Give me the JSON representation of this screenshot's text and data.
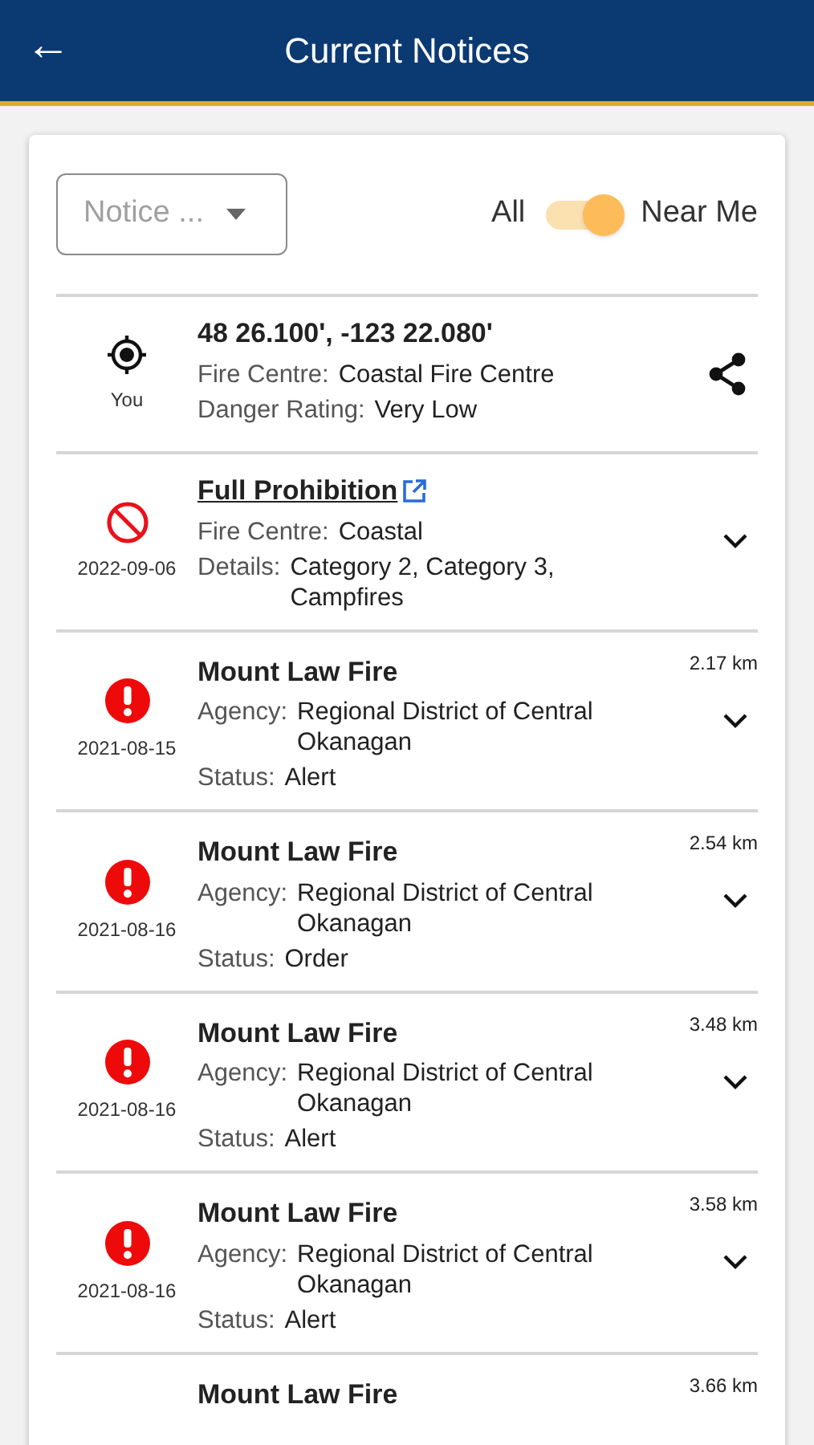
{
  "header": {
    "back": "←",
    "title": "Current Notices"
  },
  "filter": {
    "placeholder": "Notice ..."
  },
  "toggle": {
    "left_label": "All",
    "right_label": "Near Me",
    "on": true
  },
  "rows": [
    {
      "kind": "location",
      "caption": "You",
      "title": "48 26.100', -123 22.080'",
      "fields": [
        {
          "label": "Fire Centre:",
          "value": "Coastal Fire Centre"
        },
        {
          "label": "Danger Rating:",
          "value": "Very Low"
        }
      ]
    },
    {
      "kind": "prohibition",
      "caption": "2022-09-06",
      "title": "Full Prohibition",
      "fields": [
        {
          "label": "Fire Centre:",
          "value": "Coastal"
        },
        {
          "label": "Details:",
          "value": "Category 2, Category 3, Campfires"
        }
      ]
    },
    {
      "kind": "fire",
      "caption": "2021-08-15",
      "title": "Mount Law Fire",
      "distance": "2.17 km",
      "fields": [
        {
          "label": "Agency:",
          "value": "Regional District of Central Okanagan"
        },
        {
          "label": "Status:",
          "value": "Alert"
        }
      ]
    },
    {
      "kind": "fire",
      "caption": "2021-08-16",
      "title": "Mount Law Fire",
      "distance": "2.54 km",
      "fields": [
        {
          "label": "Agency:",
          "value": "Regional District of Central Okanagan"
        },
        {
          "label": "Status:",
          "value": "Order"
        }
      ]
    },
    {
      "kind": "fire",
      "caption": "2021-08-16",
      "title": "Mount Law Fire",
      "distance": "3.48 km",
      "fields": [
        {
          "label": "Agency:",
          "value": "Regional District of Central Okanagan"
        },
        {
          "label": "Status:",
          "value": "Alert"
        }
      ]
    },
    {
      "kind": "fire",
      "caption": "2021-08-16",
      "title": "Mount Law Fire",
      "distance": "3.58 km",
      "fields": [
        {
          "label": "Agency:",
          "value": "Regional District of Central Okanagan"
        },
        {
          "label": "Status:",
          "value": "Alert"
        }
      ]
    },
    {
      "kind": "fire",
      "title": "Mount Law Fire",
      "distance": "3.66 km"
    }
  ]
}
